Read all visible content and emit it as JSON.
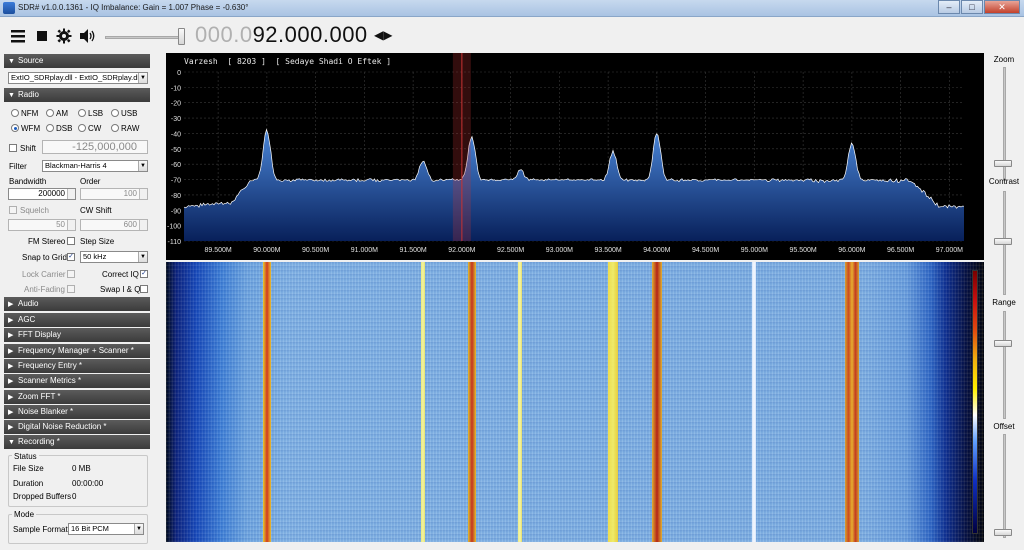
{
  "titlebar": {
    "title": "SDR# v1.0.0.1361 - IQ Imbalance: Gain = 1.007 Phase = -0.630°",
    "minimize": "–",
    "maximize": "□",
    "close": "✕"
  },
  "toolbar": {
    "freq_dim": "000.0",
    "freq_bright": "92.000.000",
    "menu_icon": "menu-icon",
    "stop_icon": "stop-icon",
    "settings_icon": "gear-icon",
    "audio_icon": "speaker-icon"
  },
  "left_panel": {
    "source": {
      "header": "Source",
      "device": "ExtIO_SDRplay.dll - ExtIO_SDRplay.dll"
    },
    "radio": {
      "header": "Radio",
      "modes": [
        {
          "label": "NFM",
          "selected": false
        },
        {
          "label": "AM",
          "selected": false
        },
        {
          "label": "LSB",
          "selected": false
        },
        {
          "label": "USB",
          "selected": false
        },
        {
          "label": "WFM",
          "selected": true
        },
        {
          "label": "DSB",
          "selected": false
        },
        {
          "label": "CW",
          "selected": false
        },
        {
          "label": "RAW",
          "selected": false
        }
      ],
      "shift_label": "Shift",
      "shift_value": "-125,000,000",
      "filter_label": "Filter",
      "filter_value": "Blackman-Harris 4",
      "bandwidth_label": "Bandwidth",
      "bandwidth_value": "200000",
      "order_label": "Order",
      "order_value": "100",
      "squelch_label": "Squelch",
      "squelch_value": "50",
      "cw_shift_label": "CW Shift",
      "cw_shift_value": "600",
      "fm_stereo_label": "FM Stereo",
      "step_size_label": "Step Size",
      "snap_label": "Snap to Grid",
      "step_value": "50 kHz",
      "lock_carrier_label": "Lock Carrier",
      "correct_iq_label": "Correct IQ",
      "anti_fading_label": "Anti-Fading",
      "swap_iq_label": "Swap I & Q"
    },
    "collapsed_sections": [
      "Audio",
      "AGC",
      "FFT Display",
      "Frequency Manager + Scanner *",
      "Frequency Entry *",
      "Scanner Metrics *",
      "Zoom FFT *",
      "Noise Blanker *",
      "Digital Noise Reduction *"
    ],
    "recording": {
      "header": "Recording *",
      "status_label": "Status",
      "file_size_label": "File Size",
      "file_size_value": "0 MB",
      "duration_label": "Duration",
      "duration_value": "00:00:00",
      "dropped_label": "Dropped Buffers",
      "dropped_value": "0",
      "mode_label": "Mode",
      "sample_format_label": "Sample Format",
      "sample_format_value": "16 Bit PCM"
    }
  },
  "spectrum": {
    "station_text": "Varzesh  [ 8203 ]  [ Sedaye Shadi O Eftek ]",
    "y_ticks": [
      "0",
      "-10",
      "-20",
      "-30",
      "-40",
      "-50",
      "-60",
      "-70",
      "-80",
      "-90",
      "-100",
      "-110"
    ],
    "x_ticks": [
      "89.500M",
      "90.000M",
      "90.500M",
      "91.000M",
      "91.500M",
      "92.000M",
      "92.500M",
      "93.000M",
      "93.500M",
      "94.000M",
      "94.500M",
      "95.000M",
      "95.500M",
      "96.000M",
      "96.500M",
      "97.000M"
    ],
    "x_range_mhz": [
      89.15,
      97.15
    ],
    "y_range_db": [
      0,
      -110
    ],
    "noise_floor_db": -70,
    "center_freq_mhz": 92.0,
    "peaks": [
      {
        "freq": 90.0,
        "db": -38
      },
      {
        "freq": 91.6,
        "db": -58
      },
      {
        "freq": 92.1,
        "db": -42
      },
      {
        "freq": 92.6,
        "db": -64
      },
      {
        "freq": 93.55,
        "db": -52
      },
      {
        "freq": 94.0,
        "db": -40
      },
      {
        "freq": 96.0,
        "db": -46
      }
    ],
    "colors": {
      "fill_top": "#4a86d8",
      "fill_bottom": "#08205a",
      "line": "#ffffff",
      "grid": "#3a3a3a",
      "marker": "#c83232"
    }
  },
  "waterfall": {
    "colorbar": "waterfall-colorbar"
  },
  "right_panel": {
    "zoom_label": "Zoom",
    "contrast_label": "Contrast",
    "range_label": "Range",
    "offset_label": "Offset"
  }
}
